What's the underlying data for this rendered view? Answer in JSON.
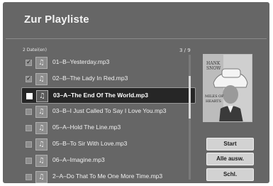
{
  "header": {
    "title": "Zur Playliste"
  },
  "info": {
    "file_count": "2 Datei(en)",
    "page": "3 / 9"
  },
  "list": {
    "items": [
      {
        "label": "01–B–Yesterday.mp3",
        "checked": true,
        "selected": false
      },
      {
        "label": "02–B–The Lady In Red.mp3",
        "checked": true,
        "selected": false
      },
      {
        "label": "03–A–The End Of The World.mp3",
        "checked": false,
        "selected": true
      },
      {
        "label": "03–B–I Just Called To Say I Love You.mp3",
        "checked": false,
        "selected": false
      },
      {
        "label": "05–A–Hold The Line.mp3",
        "checked": false,
        "selected": false
      },
      {
        "label": "05–B–To Sir With Love.mp3",
        "checked": false,
        "selected": false
      },
      {
        "label": "06–A–Imagine.mp3",
        "checked": false,
        "selected": false
      },
      {
        "label": "2–A–Do That To Me One More Time.mp3",
        "checked": false,
        "selected": false
      }
    ]
  },
  "cover": {
    "text_lines": [
      "HANK",
      "SNOW",
      "MILES OF",
      "HEARTS"
    ]
  },
  "buttons": {
    "start": "Start",
    "select_all": "Alle ausw.",
    "close": "Schl."
  },
  "icons": {
    "check": "checkmark-icon",
    "music": "music-note-icon"
  }
}
